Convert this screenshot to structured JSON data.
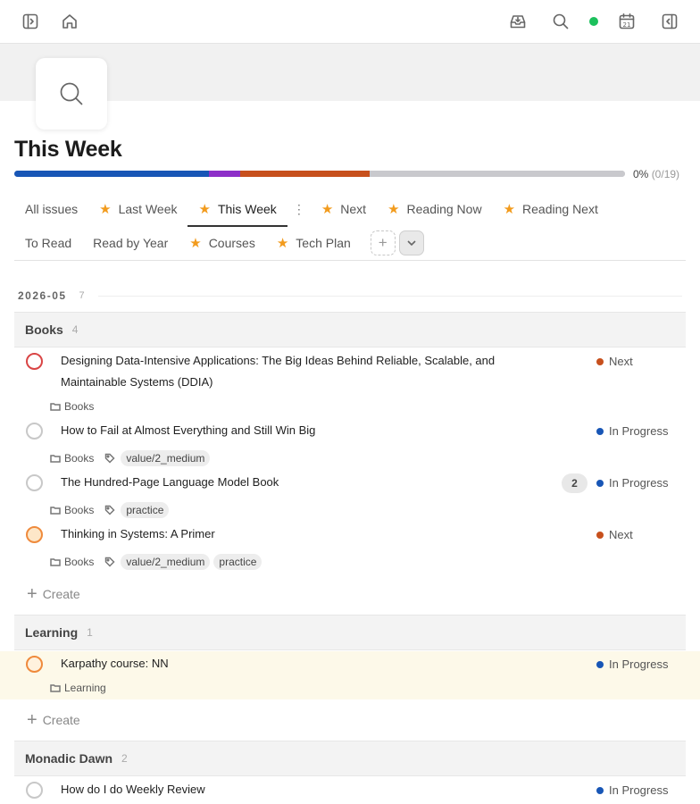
{
  "colors": {
    "status_green": "#1cc05c",
    "next": "#c7501d",
    "in_progress": "#1856b6",
    "star": "#f29b1d"
  },
  "topbar": {
    "icons": [
      "sidebar-left-icon",
      "home-icon",
      "inbox-icon",
      "search-icon",
      "calendar-icon",
      "sidebar-right-icon"
    ],
    "calendar_day": "21"
  },
  "page": {
    "icon": "search-icon",
    "title": "This Week",
    "progress_text": "0%",
    "progress_count": "(0/19)",
    "progress_segments": [
      {
        "name": "blue",
        "color": "#1856b6",
        "fraction": 0.318
      },
      {
        "name": "purple",
        "color": "#8d2fc8",
        "fraction": 0.052
      },
      {
        "name": "orange",
        "color": "#c7501d",
        "fraction": 0.212
      },
      {
        "name": "gray",
        "color": "#c9c9cd",
        "fraction": 0.418
      }
    ]
  },
  "tabs": {
    "row1": [
      {
        "label": "All issues",
        "star": false,
        "active": false
      },
      {
        "label": "Last Week",
        "star": true,
        "active": false
      },
      {
        "label": "This Week",
        "star": true,
        "active": true
      },
      {
        "label": "Next",
        "star": true,
        "active": false
      },
      {
        "label": "Reading Now",
        "star": true,
        "active": false
      },
      {
        "label": "Reading Next",
        "star": true,
        "active": false
      }
    ],
    "more": "⋮",
    "row2": [
      {
        "label": "To Read",
        "star": false
      },
      {
        "label": "Read by Year",
        "star": false
      },
      {
        "label": "Courses",
        "star": true
      },
      {
        "label": "Tech Plan",
        "star": true
      }
    ]
  },
  "date_group": {
    "label": "2026-05",
    "count": "7"
  },
  "groups": [
    {
      "name": "Books",
      "count": "4",
      "issues": [
        {
          "title_lines": [
            "Designing Data-Intensive Applications: The Big Ideas Behind Reliable, Scalable, and",
            "Maintainable Systems (DDIA)"
          ],
          "circle": "red",
          "project": "Books",
          "labels": [],
          "status": "Next",
          "status_color": "#c7501d",
          "badge": ""
        },
        {
          "title_lines": [
            "How to Fail at Almost Everything and Still Win Big"
          ],
          "circle": "gray",
          "project": "Books",
          "labels": [
            "value/2_medium"
          ],
          "status": "In Progress",
          "status_color": "#1856b6",
          "badge": ""
        },
        {
          "title_lines": [
            "The Hundred-Page Language Model Book"
          ],
          "circle": "gray",
          "project": "Books",
          "labels": [
            "practice"
          ],
          "status": "In Progress",
          "status_color": "#1856b6",
          "badge": "2"
        },
        {
          "title_lines": [
            "Thinking in Systems: A Primer"
          ],
          "circle": "orange",
          "project": "Books",
          "labels": [
            "value/2_medium",
            "practice"
          ],
          "status": "Next",
          "status_color": "#c7501d",
          "badge": ""
        }
      ],
      "create_label": "Create"
    },
    {
      "name": "Learning",
      "count": "1",
      "issues": [
        {
          "title_lines": [
            "Karpathy course: NN"
          ],
          "circle": "orange-o",
          "project": "Learning",
          "labels": [],
          "status": "In Progress",
          "status_color": "#1856b6",
          "badge": ""
        }
      ],
      "create_label": "Create"
    },
    {
      "name": "Monadic Dawn",
      "count": "2",
      "issues": [
        {
          "title_lines": [
            "How do I do Weekly Review"
          ],
          "circle": "gray",
          "project": "",
          "labels": [],
          "status": "In Progress",
          "status_color": "#1856b6",
          "badge": ""
        }
      ]
    }
  ]
}
